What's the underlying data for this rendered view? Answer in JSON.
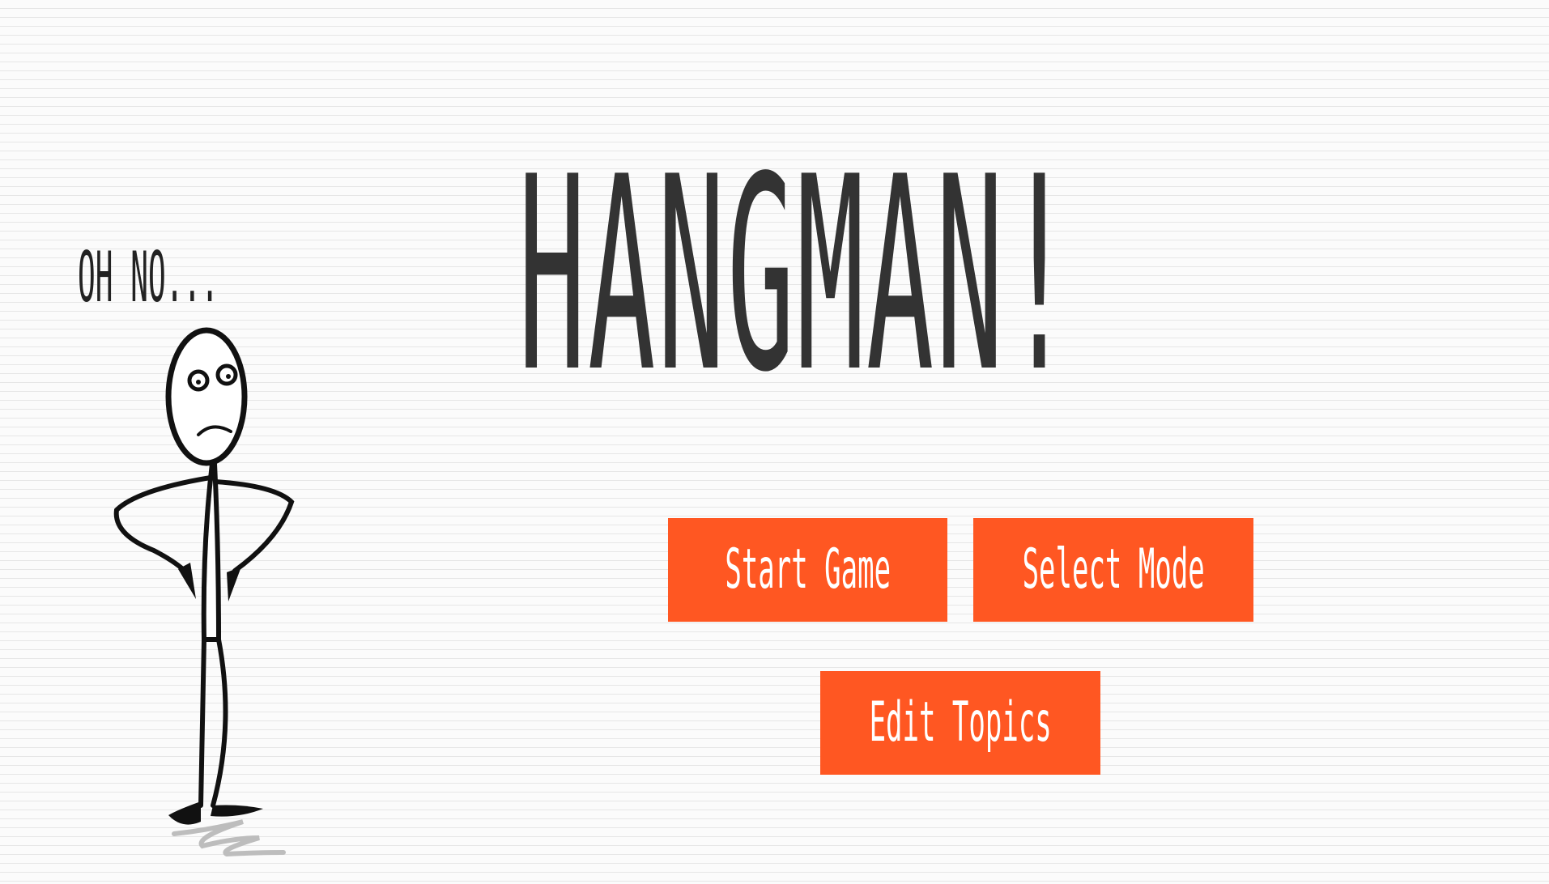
{
  "title": "HANGMAN!",
  "speech_bubble": "OH NO...",
  "menu": {
    "start_game": "Start Game",
    "select_mode": "Select Mode",
    "edit_topics": "Edit Topics"
  },
  "colors": {
    "button_background": "#ff5722",
    "button_text": "#ffffff",
    "title_text": "#333333",
    "paper_background": "#fbfbfb",
    "paper_lines": "#e6e6e6"
  },
  "icons": {
    "character": "stickman-icon"
  }
}
